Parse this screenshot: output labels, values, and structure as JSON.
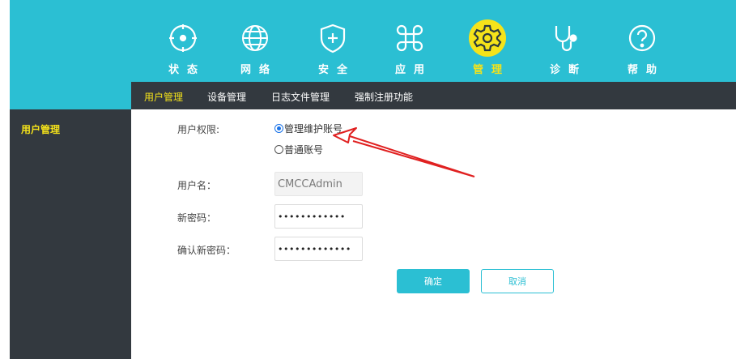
{
  "colors": {
    "accent": "#2bbfd3",
    "active": "#f5e31a",
    "dark": "#33393f",
    "annotation": "#e02020"
  },
  "nav": [
    {
      "label": "状态",
      "icon": "status-icon"
    },
    {
      "label": "网络",
      "icon": "globe-icon"
    },
    {
      "label": "安全",
      "icon": "shield-icon"
    },
    {
      "label": "应用",
      "icon": "command-icon"
    },
    {
      "label": "管理",
      "icon": "gear-icon",
      "active": true
    },
    {
      "label": "诊断",
      "icon": "stethoscope-icon"
    },
    {
      "label": "帮助",
      "icon": "help-icon"
    }
  ],
  "subnav": [
    {
      "label": "用户管理",
      "active": true
    },
    {
      "label": "设备管理"
    },
    {
      "label": "日志文件管理"
    },
    {
      "label": "强制注册功能"
    }
  ],
  "sidebar": {
    "items": [
      {
        "label": "用户管理",
        "active": true
      }
    ]
  },
  "form": {
    "permission_label": "用户权限:",
    "permission_options": [
      {
        "label": "管理维护账号",
        "checked": true
      },
      {
        "label": "普通账号",
        "checked": false
      }
    ],
    "username_label": "用户名：",
    "username_value": "CMCCAdmin",
    "new_password_label": "新密码：",
    "new_password_value": "••••••••••••",
    "confirm_password_label": "确认新密码：",
    "confirm_password_value": "•••••••••••••",
    "confirm_button": "确定",
    "cancel_button": "取消"
  }
}
